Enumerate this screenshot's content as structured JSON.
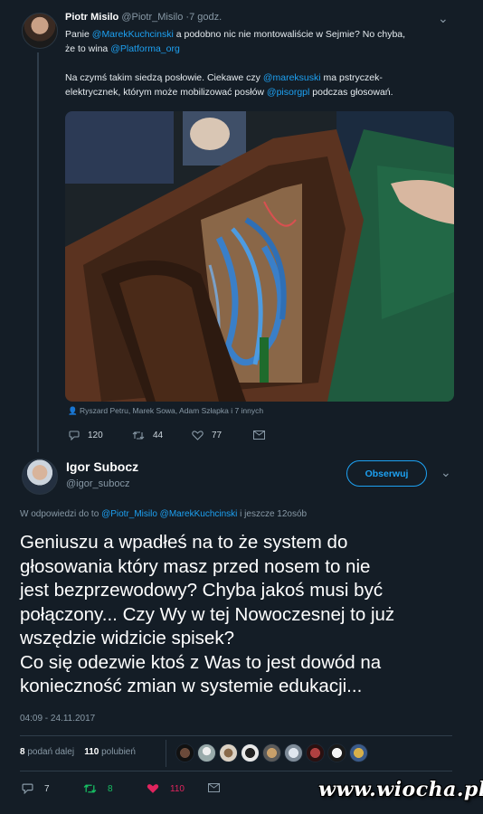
{
  "tweet1": {
    "author_name": "Piotr Misilo",
    "author_handle": "@Piotr_Misilo",
    "time": "·7 godz.",
    "line1_a": "Panie ",
    "line1_mention": "@MarekKuchcinski",
    "line1_b": " a podobno nic nie montowaliście w Sejmie? No chyba,",
    "line2_a": "że to wina ",
    "line2_mention": "@Platforma_org",
    "line3_a": "Na czymś takim siedzą posłowie. Ciekawe czy ",
    "line3_mention": "@mareksuski",
    "line3_b": " ma pstryczek-",
    "line4_a": "elektrycznek, którym może mobilizować posłów ",
    "line4_mention": "@pisorgpl",
    "line4_b": " podczas głosowań.",
    "photo_tags": "Ryszard Petru, Marek Sowa, Adam Szłapka i 7 innych",
    "replies": "120",
    "retweets": "44",
    "likes": "77"
  },
  "tweet2": {
    "author_name": "Igor Subocz",
    "author_handle": "@igor_subocz",
    "follow_label": "Obserwuj",
    "reply_prefix": "W odpowiedzi do to ",
    "reply_mentions": "@Piotr_Misilo @MarekKuchcinski",
    "reply_suffix": " i jeszcze 12osób",
    "text_lines": [
      "Geniuszu a wpadłeś na to że system do",
      "głosowania który masz przed nosem to nie",
      "jest bezprzewodowy? Chyba jakoś musi być",
      "połączony... Czy Wy w tej Nowoczesnej to już",
      "wszędzie widzicie spisek?",
      "Co się odezwie ktoś z Was to jest dowód na",
      "konieczność zmian w systemie  edukacji..."
    ],
    "timestamp": "04:09 - 24.11.2017",
    "retweet_count": "8",
    "retweet_label": " podań dalej",
    "like_count": "110",
    "like_label": " polubień",
    "replies": "7",
    "retweets": "8",
    "likes": "110"
  },
  "watermark": "www.wiocha.pl",
  "colors": {
    "background": "#141d26",
    "accent": "#1da1f2",
    "muted": "#8899a6",
    "retweet": "#17bf63",
    "like": "#e0245e"
  },
  "icons": [
    "chevron-down-icon",
    "reply-icon",
    "retweet-icon",
    "heart-icon",
    "mail-icon",
    "person-icon"
  ]
}
